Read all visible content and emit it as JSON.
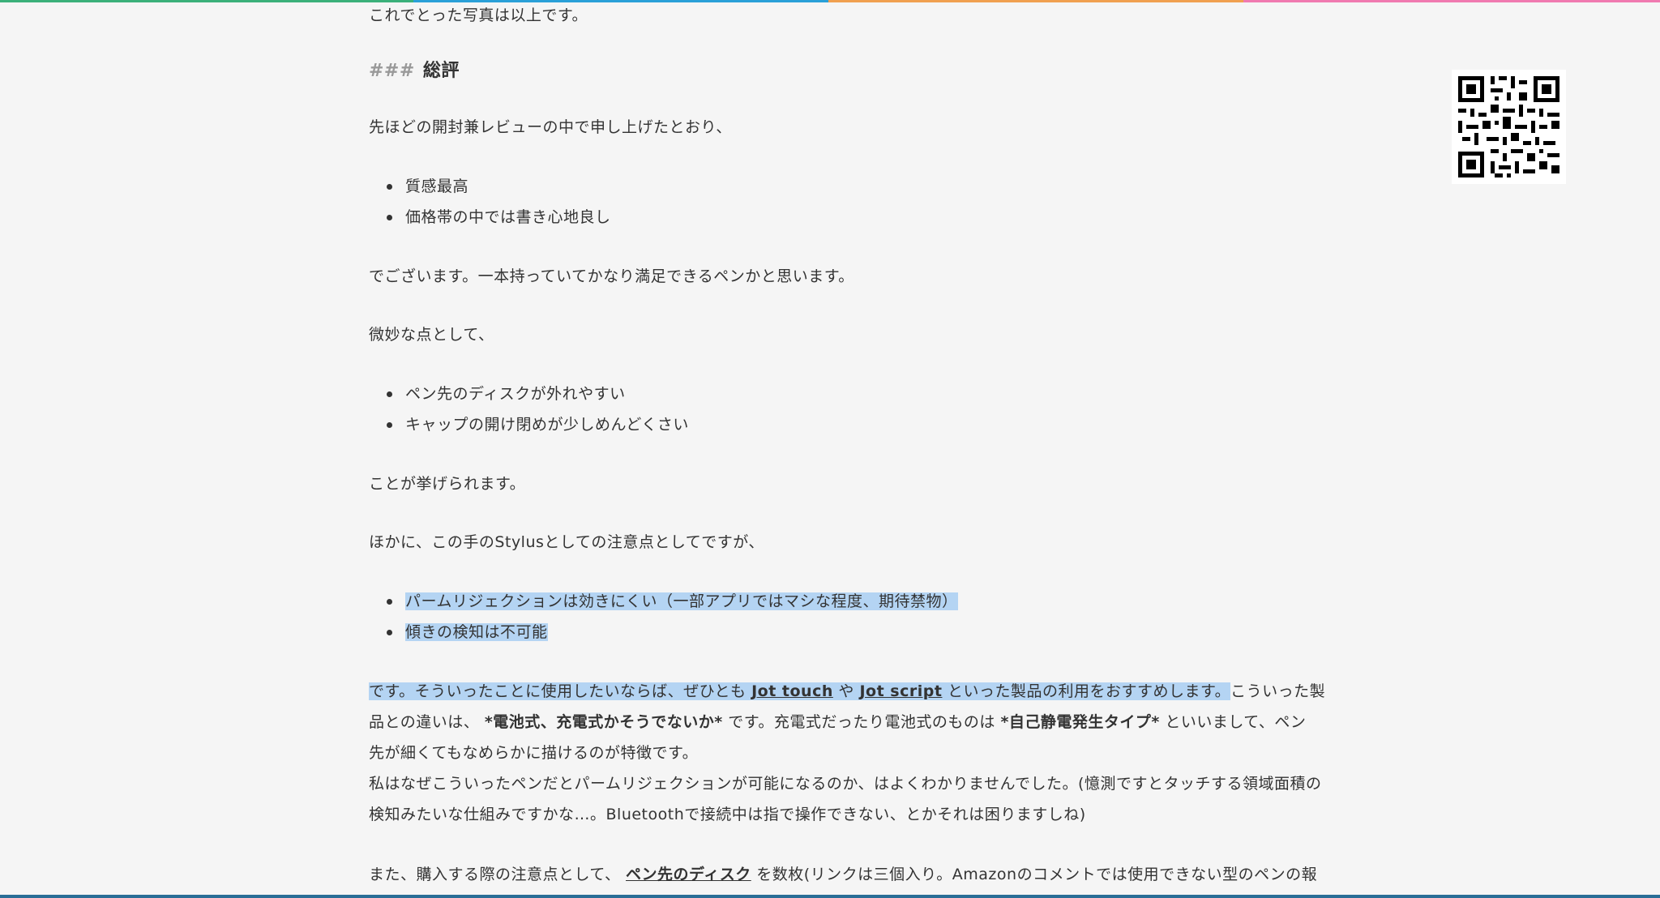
{
  "colors": {
    "topbar": [
      "#3bb07a",
      "#2aa0d8",
      "#f0a050",
      "#f07ab0",
      "#f5f5f5"
    ],
    "bottombar": "#2a6d96",
    "selection": "#b4d4f3"
  },
  "article": {
    "intro_end": "これでとった写真は以上です。",
    "heading_marker": "###",
    "heading": "総評",
    "p_review_ref": "先ほどの開封兼レビューの中で申し上げたとおり、",
    "pros": [
      "質感最高",
      "価格帯の中では書き心地良し"
    ],
    "p_summary": "でございます。一本持っていてかなり満足できるペンかと思います。",
    "p_cons_intro": "微妙な点として、",
    "cons": [
      "ペン先のディスクが外れやすい",
      "キャップの開け閉めが少しめんどくさい"
    ],
    "p_cons_end": "ことが挙げられます。",
    "p_stylus_intro": "ほかに、この手のStylusとしての注意点としてですが、",
    "stylus_notes": [
      "パームリジェクションは効きにくい（一部アプリではマシな程度、期待禁物）",
      "傾きの検知は不可能"
    ],
    "p_recommend": {
      "a": "です。そういったことに使用したいならば、ぜひとも",
      "link1": "Jot touch",
      "b": "や",
      "link2": "Jot script",
      "c": "といった製品の利用をおすすめします。",
      "d": "こういった製",
      "e": "品との違いは、",
      "bold1": "*電池式、充電式かそうでないか*",
      "f": "です。充電式だったり電池式のものは",
      "bold2": "*自己静電発生タイプ*",
      "g": "といいまして、ペン",
      "h": "先が細くてもなめらかに描けるのが特徴です。"
    },
    "p_palm": {
      "line1": "私はなぜこういったペンだとパームリジェクションが可能になるのか、はよくわかりませんでした。(憶測ですとタッチする領域面積の",
      "line2": "検知みたいな仕組みですかな…。Bluetoothで接続中は指で操作できない、とかそれは困りますしね)"
    },
    "p_purchase": {
      "a": "また、購入する際の注意点として、",
      "link": "ペン先のディスク",
      "b": "を数枚(リンクは三個入り。Amazonのコメントでは使用できない型のペンの報"
    }
  },
  "qr": {
    "icon": "qr-code-icon"
  }
}
